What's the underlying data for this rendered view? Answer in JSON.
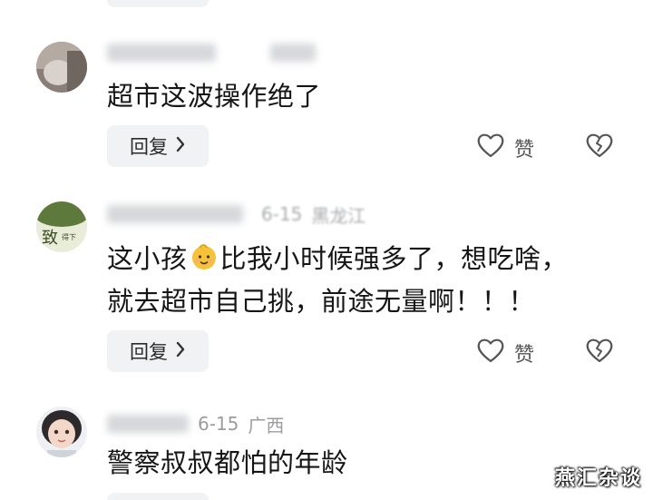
{
  "comments": [
    {
      "text_lines": [
        "超市这波操作绝了"
      ],
      "reply_label": "回复",
      "like_label": "赞"
    },
    {
      "meta": {
        "date": "6-15",
        "location": "黑龙江"
      },
      "text_before_emoji": "这小孩",
      "emoji": "baby-emoji",
      "text_after_emoji": "比我小时候强多了，想吃啥，",
      "text_line2": "就去超市自己挑，前途无量啊！！！",
      "reply_label": "回复",
      "like_label": "赞"
    },
    {
      "meta": {
        "date": "6-15",
        "location": "广西"
      },
      "text_lines": [
        "警察叔叔都怕的年龄"
      ]
    }
  ],
  "watermark": "燕汇杂谈",
  "icons": {
    "like": "heart-outline-icon",
    "dislike": "broken-heart-icon",
    "chevron": "chevron-right-icon"
  },
  "colors": {
    "reply_bg": "#f1f2f4",
    "meta_gray": "#9a9ca0",
    "text": "#161616"
  }
}
